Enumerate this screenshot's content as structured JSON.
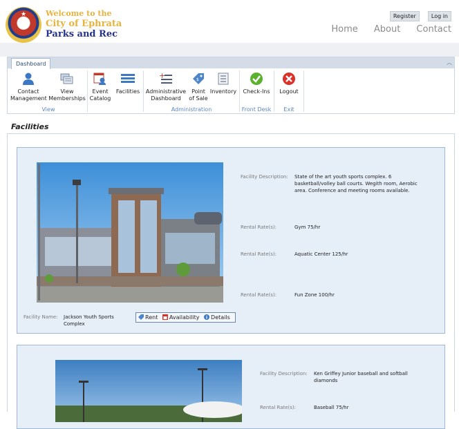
{
  "header": {
    "logo_line1": "Welcome to the",
    "logo_line2": "City of Ephrata",
    "logo_line3": "Parks and Rec",
    "register": "Register",
    "login": "Log in",
    "nav": [
      "Home",
      "About",
      "Contact"
    ]
  },
  "ribbon": {
    "tab": "Dashboard",
    "buttons": {
      "contact_management": "Contact\nManagement",
      "view_memberships": "View\nMemberships",
      "event_catalog": "Event\nCatalog",
      "facilities": "Facilities",
      "admin_dashboard": "Administrative\nDashboard",
      "point_of_sale": "Point\nof Sale",
      "inventory": "Inventory",
      "check_ins": "Check-Ins",
      "logout": "Logout"
    },
    "groups": {
      "view": "View",
      "administration": "Administration",
      "front_desk": "Front Desk",
      "exit": "Exit"
    }
  },
  "page_title": "Facilities",
  "facilities": [
    {
      "description_label": "Facility Description:",
      "description": "State of the art youth sports complex. 6 basketball/volley ball courts. Wegith room, Aerobic area. Conference and meeting rooms available.",
      "rates": [
        {
          "label": "Rental Rate(s):",
          "value": "Gym 75/hr"
        },
        {
          "label": "Rental Rate(s):",
          "value": "Aquatic Center 125/hr"
        },
        {
          "label": "Rental Rate(s):",
          "value": "Fun Zone 100/hr"
        }
      ],
      "name_label": "Facility Name:",
      "name": "Jackson Youth Sports Complex",
      "actions": {
        "rent": "Rent",
        "availability": "Availability",
        "details": "Details"
      }
    },
    {
      "description_label": "Facility Description:",
      "description": "Ken Griffey Junior baseball and softball diamonds",
      "rates": [
        {
          "label": "Rental Rate(s):",
          "value": "Baseball 75/hr"
        }
      ]
    }
  ],
  "colors": {
    "accent_blue": "#5a86c8",
    "card_bg": "#e6eef8",
    "card_border": "#9eb7d3"
  }
}
